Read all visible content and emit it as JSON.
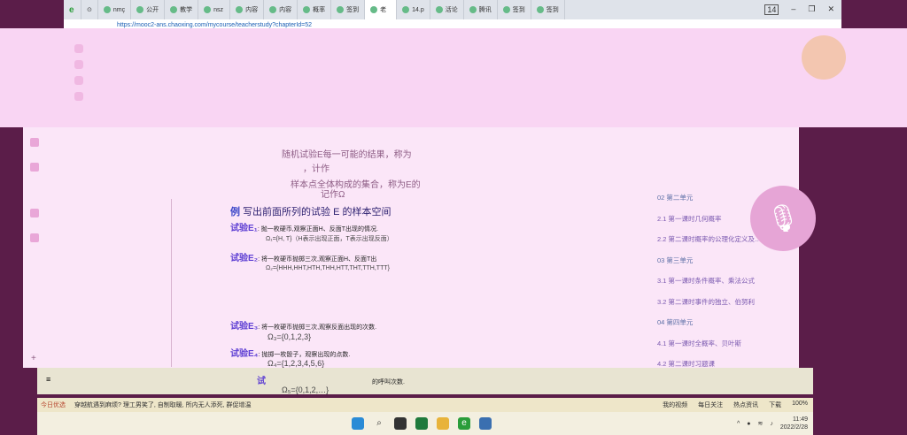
{
  "browser": {
    "tabs": [
      "nmç",
      "公开",
      "教学",
      "nsz",
      "内容",
      "内容",
      "概率",
      "签到",
      "老",
      "14.p",
      "活论",
      "腾讯",
      "签到",
      "签到"
    ],
    "active_tab_index": 8,
    "tab_count_badge": "14",
    "url": "https://mooc2-ans.chaoxing.com/mycourse/teacherstudy?chapterId=52"
  },
  "slide": {
    "line1": "随机试验E每一可能的结果，称为",
    "line2": "，计作",
    "line3": "样本点全体构成的集合，称为E的",
    "line4": "记作Ω",
    "example_prefix": "例",
    "example_title": "写出前面所列的试验 E",
    "example_suffix": "的样本空间",
    "trials": [
      {
        "label": "试验E₁",
        "text": ": 抛一枚硬币,观察正面H、反面T出现的情况.",
        "omega": "Ω₁={H, T}（H表示出现正面，T表示出现反面）"
      },
      {
        "label": "试验E₂",
        "text": ": 将一枚硬币抛掷三次,观察正面H、反面T出",
        "omega": "Ω₂={HHH,HHT,HTH,THH,HTT,THT,TTH,TTT}"
      },
      {
        "label": "试验E₃",
        "text": ": 将一枚硬币抛掷三次,观察反面出现的次数.",
        "omega": "Ω₃={0,1,2,3}"
      },
      {
        "label": "试验E₄",
        "text": ": 抛掷一枚骰子，观察出现的点数.",
        "omega": "Ω₄={1,2,3,4,5,6}"
      },
      {
        "label": "试",
        "text": "的呼叫次数.",
        "omega": "Ω₅={0,1,2,…}"
      }
    ]
  },
  "chapters": [
    {
      "label": "02 第二单元",
      "kind": "unit"
    },
    {
      "label": "2.1 第一课时几何概率",
      "kind": "sec"
    },
    {
      "label": "2.2 第二课时概率的公理化定义及…",
      "kind": "sec"
    },
    {
      "label": "03 第三单元",
      "kind": "unit"
    },
    {
      "label": "3.1 第一课时条件概率、乘法公式",
      "kind": "sec"
    },
    {
      "label": "3.2 第二课时事件的独立、伯努利",
      "kind": "sec"
    },
    {
      "label": "04 第四单元",
      "kind": "unit"
    },
    {
      "label": "4.1 第一课时全概率、贝叶斯",
      "kind": "sec"
    },
    {
      "label": "4.2 第二课时习题课",
      "kind": "sec"
    }
  ],
  "newsbar": {
    "today": "今日优选",
    "headline": "穿越航遇到麻烦? 理工男笑了, 自制取暖, 所内无人添死, 群促增温",
    "my_video": "我的视频",
    "daily_follow": "每日关注",
    "hot_news": "热点资讯",
    "download": "下载",
    "zoom": "100%"
  },
  "taskbar": {
    "time": "11:49",
    "date": "2022/2/28"
  }
}
